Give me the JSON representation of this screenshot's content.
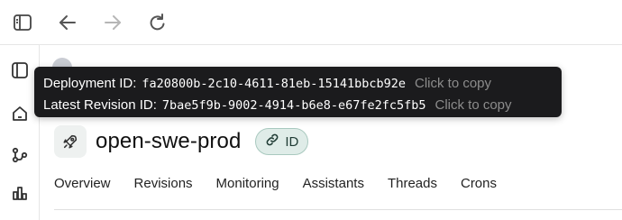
{
  "tooltip": {
    "deployment_label": "Deployment ID:",
    "deployment_value": "fa20800b-2c10-4611-81eb-15141bbcb92e",
    "deployment_copy": "Click to copy",
    "revision_label": "Latest Revision ID:",
    "revision_value": "7bae5f9b-9002-4914-b6e8-e67fe2fc5fb5",
    "revision_copy": "Click to copy"
  },
  "page": {
    "title": "open-swe-prod",
    "id_chip_label": "ID"
  },
  "tabs": [
    "Overview",
    "Revisions",
    "Monitoring",
    "Assistants",
    "Threads",
    "Crons"
  ],
  "icons": {
    "topbar": [
      "sidebar-toggle-icon",
      "back-arrow-icon",
      "forward-arrow-icon",
      "reload-icon"
    ],
    "rail": [
      "panel-icon",
      "home-icon",
      "graph-icon",
      "bar-chart-icon"
    ],
    "title": "rocket-icon",
    "chip": "link-icon"
  }
}
